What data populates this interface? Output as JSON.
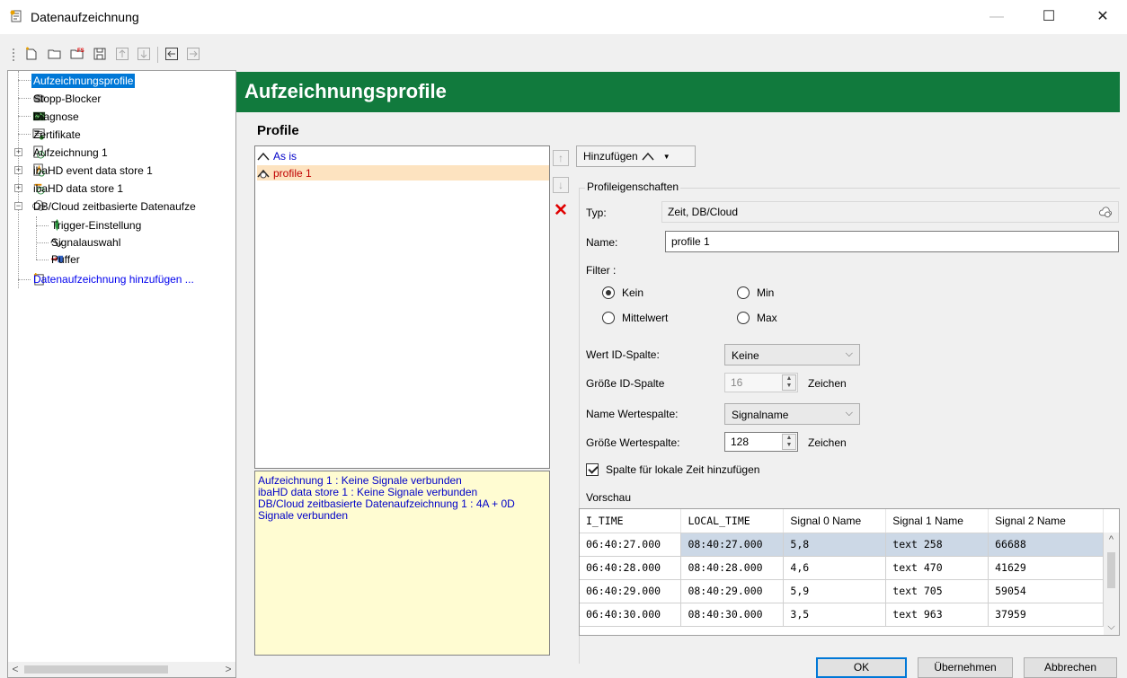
{
  "window": {
    "title": "Datenaufzeichnung",
    "controls": {
      "minimize": "—",
      "maximize": "☐",
      "close": "✕"
    }
  },
  "toolbar": {
    "icons": [
      "new-icon",
      "open-folder-icon",
      "fs-icon",
      "save-icon",
      "move-up-icon",
      "move-down-icon",
      "collapse-icon",
      "expand-icon"
    ]
  },
  "tree": {
    "items": [
      {
        "label": "Aufzeichnungsprofile",
        "icon": "profile-clock-icon"
      },
      {
        "label": "Stopp-Blocker",
        "icon": "stop-icon"
      },
      {
        "label": "Diagnose",
        "icon": "diagnosis-icon"
      },
      {
        "label": "Zertifikate",
        "icon": "certificate-icon"
      },
      {
        "label": "Aufzeichnung 1",
        "icon": "recording-icon"
      },
      {
        "label": "ibaHD event data store 1",
        "icon": "event-store-icon"
      },
      {
        "label": "ibaHD data store 1",
        "icon": "data-store-icon"
      },
      {
        "label": "DB/Cloud zeitbasierte Datenaufze",
        "icon": "cloud-store-icon"
      },
      {
        "label": "Trigger-Einstellung",
        "icon": "trigger-icon"
      },
      {
        "label": "Signalauswahl",
        "icon": "signal-icon"
      },
      {
        "label": "Puffer",
        "icon": "buffer-icon"
      },
      {
        "label": "Datenaufzeichnung hinzufügen ...",
        "icon": "add-recording-icon"
      }
    ],
    "scroll_left": "<",
    "scroll_right": ">"
  },
  "header": {
    "title": "Aufzeichnungsprofile"
  },
  "profiles": {
    "title": "Profile",
    "items": [
      {
        "label": "As is"
      },
      {
        "label": "profile 1"
      }
    ],
    "info_lines": [
      "Aufzeichnung 1 : Keine Signale verbunden",
      "ibaHD data store 1 : Keine Signale verbunden",
      "DB/Cloud zeitbasierte Datenaufzeichnung 1 : 4A + 0D",
      "Signale verbunden"
    ],
    "side_buttons": {
      "up": "↑",
      "down": "↓",
      "delete": "✕"
    }
  },
  "add_button": {
    "label": "Hinzufügen",
    "caret": "▼"
  },
  "properties": {
    "legend": "Profileigenschaften",
    "type_label": "Typ:",
    "type_value": "Zeit, DB/Cloud",
    "name_label": "Name:",
    "name_value": "profile 1",
    "filter_label": "Filter :",
    "filter_options": [
      "Kein",
      "Min",
      "Mittelwert",
      "Max"
    ],
    "filter_selected": "Kein",
    "id_col_label": "Wert ID-Spalte:",
    "id_col_value": "Keine",
    "id_size_label": "Größe ID-Spalte",
    "id_size_value": "16",
    "id_size_unit": "Zeichen",
    "value_col_label": "Name Wertespalte:",
    "value_col_value": "Signalname",
    "value_size_label": "Größe Wertespalte:",
    "value_size_value": "128",
    "value_size_unit": "Zeichen",
    "local_time_label": "Spalte für lokale Zeit hinzufügen",
    "local_time_checked": true
  },
  "preview": {
    "label": "Vorschau",
    "columns": [
      "I_TIME",
      "LOCAL_TIME",
      "Signal 0 Name",
      "Signal 1 Name",
      "Signal 2 Name"
    ],
    "rows": [
      [
        "06:40:27.000",
        "08:40:27.000",
        "5,8",
        "text 258",
        "66688"
      ],
      [
        "06:40:28.000",
        "08:40:28.000",
        "4,6",
        "text 470",
        "41629"
      ],
      [
        "06:40:29.000",
        "08:40:29.000",
        "5,9",
        "text 705",
        "59054"
      ],
      [
        "06:40:30.000",
        "08:40:30.000",
        "3,5",
        "text 963",
        "37959"
      ]
    ]
  },
  "buttons": {
    "ok": "OK",
    "apply": "Übernehmen",
    "cancel": "Abbrechen"
  },
  "colors": {
    "header_bg": "#117a3d",
    "selection": "#0078d7",
    "link": "#0000c8",
    "profile_sel_bg": "#fde3c0"
  }
}
